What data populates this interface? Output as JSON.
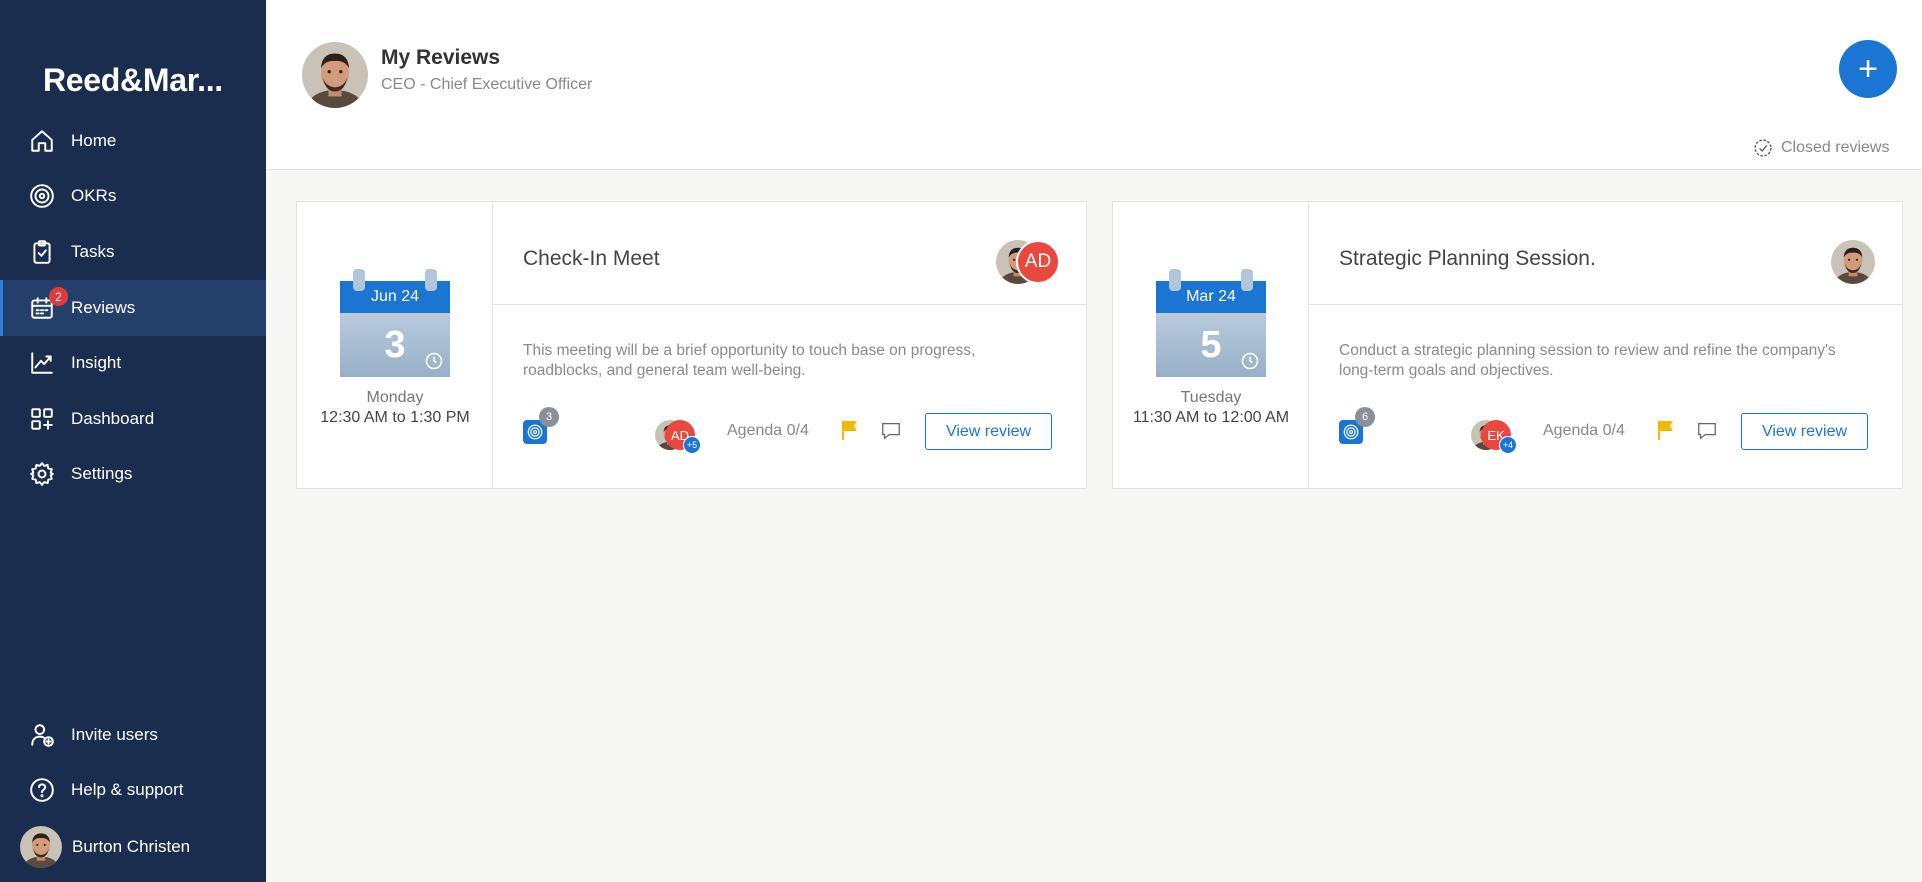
{
  "sidebar": {
    "brand": "Reed&Mar...",
    "items": [
      {
        "label": "Home",
        "icon": "home-icon"
      },
      {
        "label": "OKRs",
        "icon": "target-icon"
      },
      {
        "label": "Tasks",
        "icon": "clipboard-icon"
      },
      {
        "label": "Reviews",
        "icon": "calendar-icon",
        "badge": "2",
        "active": true
      },
      {
        "label": "Insight",
        "icon": "chart-line-icon"
      },
      {
        "label": "Dashboard",
        "icon": "dashboard-grid-icon"
      },
      {
        "label": "Settings",
        "icon": "gear-icon"
      }
    ],
    "bottom": [
      {
        "label": "Invite users",
        "icon": "user-plus-icon"
      },
      {
        "label": "Help & support",
        "icon": "help-circle-icon"
      }
    ],
    "user_name": "Burton Christen"
  },
  "header": {
    "title": "My Reviews",
    "subtitle": "CEO - Chief Executive Officer",
    "add_label": "+",
    "closed_reviews": "Closed reviews"
  },
  "reviews": [
    {
      "month": "Jun 24",
      "day": "3",
      "weekday": "Monday",
      "time": "12:30 AM to 1:30 PM",
      "title": "Check-In Meet",
      "header_initials": "AD",
      "description": "This meeting will be a brief opportunity to touch base on progress, roadblocks, and general team well-being.",
      "okr_count": "3",
      "participant_initials": "AD",
      "participant_more": "+5",
      "agenda": "Agenda 0/4",
      "view_label": "View review"
    },
    {
      "month": "Mar 24",
      "day": "5",
      "weekday": "Tuesday",
      "time": "11:30 AM to 12:00 AM",
      "title": "Strategic Planning Session.",
      "description": "Conduct a strategic planning session to review and refine the company's long-term goals and objectives.",
      "okr_count": "6",
      "participant_initials": "EK",
      "participant_more": "+4",
      "agenda": "Agenda 0/4",
      "view_label": "View review"
    }
  ],
  "colors": {
    "sidebar_bg": "#1b2d4f",
    "sidebar_active": "#243f6a",
    "accent": "#1a76d2",
    "badge_red": "#e03a3a",
    "initials_red": "#e8483e",
    "flag": "#f5b800"
  }
}
